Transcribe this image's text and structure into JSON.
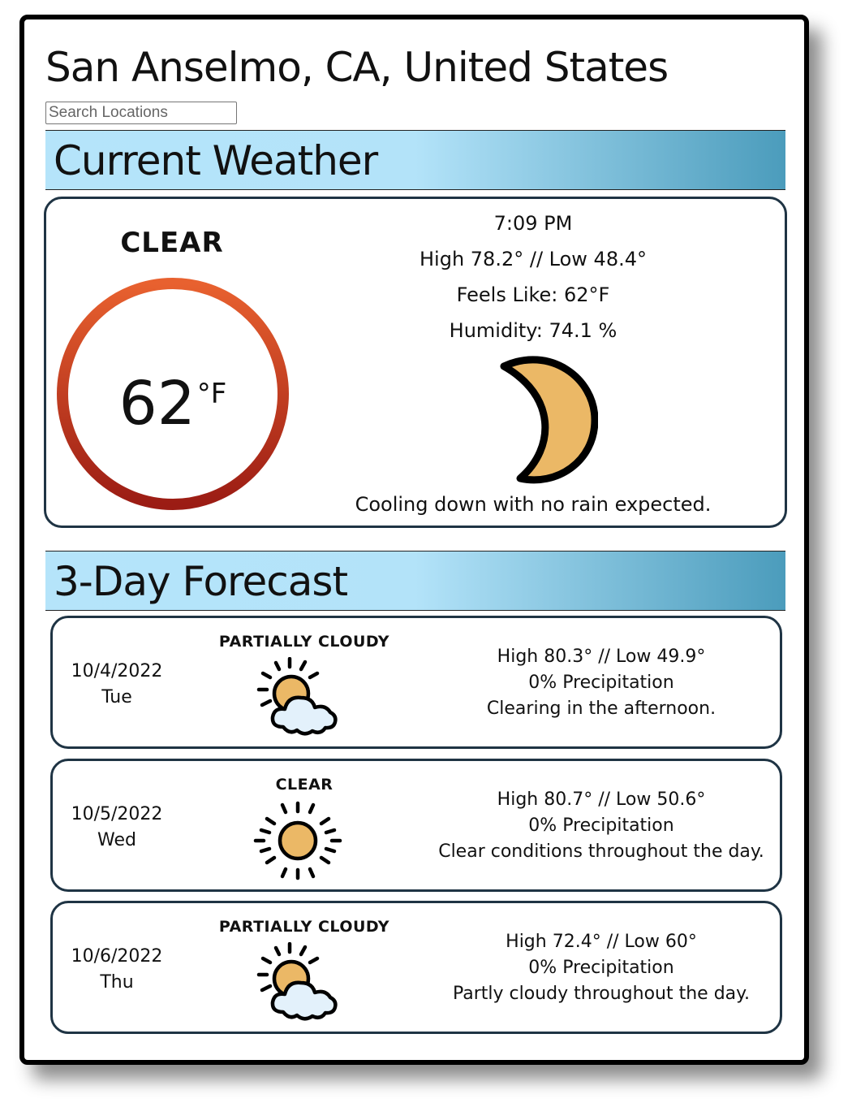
{
  "location": {
    "title": "San Anselmo, CA, United States"
  },
  "search": {
    "placeholder": "Search Locations"
  },
  "current": {
    "header": "Current Weather",
    "condition": "CLEAR",
    "temperature": "62",
    "unit": "°F",
    "time": "7:09 PM",
    "high_low": "High 78.2° // Low 48.4°",
    "feels_like": "Feels Like: 62°F",
    "humidity": "Humidity: 74.1 %",
    "description": "Cooling down with no rain expected.",
    "icon": "moon-icon"
  },
  "forecast": {
    "header": "3-Day Forecast",
    "days": [
      {
        "date": "10/4/2022",
        "weekday": "Tue",
        "condition": "PARTIALLY CLOUDY",
        "icon": "partly-cloudy-icon",
        "high_low": "High 80.3° // Low 49.9°",
        "precipitation": "0% Precipitation",
        "description": "Clearing in the afternoon."
      },
      {
        "date": "10/5/2022",
        "weekday": "Wed",
        "condition": "CLEAR",
        "icon": "sun-icon",
        "high_low": "High 80.7° // Low 50.6°",
        "precipitation": "0% Precipitation",
        "description": "Clear conditions throughout the day."
      },
      {
        "date": "10/6/2022",
        "weekday": "Thu",
        "condition": "PARTIALLY CLOUDY",
        "icon": "partly-cloudy-icon",
        "high_low": "High 72.4° // Low 60°",
        "precipitation": "0% Precipitation",
        "description": "Partly cloudy throughout the day."
      }
    ]
  },
  "colors": {
    "ring_top": "#e8612f",
    "ring_bottom": "#9b1c14",
    "moon_fill": "#ebb866",
    "sun_fill": "#ebb866",
    "cloud_fill": "#e3f1fb",
    "header_light": "#b5e4fa",
    "header_dark": "#4b9cbc",
    "card_border": "#1f3444"
  }
}
